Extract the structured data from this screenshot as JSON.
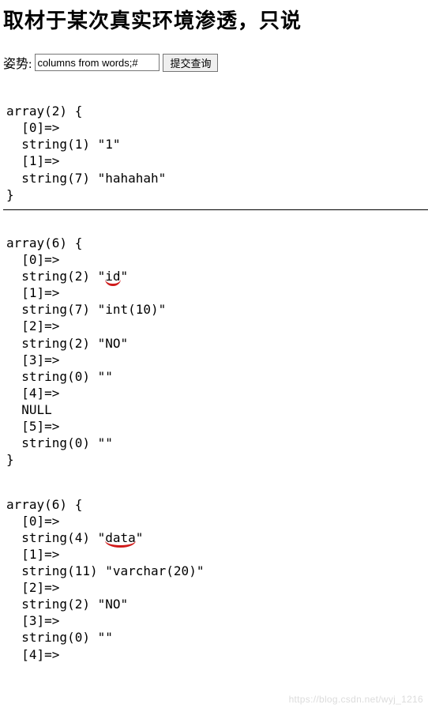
{
  "title": "取材于某次真实环境渗透，只说",
  "form": {
    "label": "姿势:",
    "input_value": "columns from words;#",
    "submit_label": "提交查询"
  },
  "dump1": {
    "header": "array(2) {",
    "lines": [
      "  [0]=>",
      "  string(1) \"1\"",
      "  [1]=>",
      "  string(7) \"hahahah\""
    ],
    "footer": "}"
  },
  "dump2": {
    "header": "array(6) {",
    "l0": "  [0]=>",
    "l1_pre": "  string(2) \"",
    "l1_mark": "id",
    "l1_post": "\"",
    "lines_rest": [
      "  [1]=>",
      "  string(7) \"int(10)\"",
      "  [2]=>",
      "  string(2) \"NO\"",
      "  [3]=>",
      "  string(0) \"\"",
      "  [4]=>",
      "  NULL",
      "  [5]=>",
      "  string(0) \"\""
    ],
    "footer": "}"
  },
  "dump3": {
    "header": "array(6) {",
    "l0": "  [0]=>",
    "l1_pre": "  string(4) \"",
    "l1_mark": "data",
    "l1_post": "\"",
    "lines_rest": [
      "  [1]=>",
      "  string(11) \"varchar(20)\"",
      "  [2]=>",
      "  string(2) \"NO\"",
      "  [3]=>",
      "  string(0) \"\"",
      "  [4]=>"
    ]
  },
  "watermark": "https://blog.csdn.net/wyj_1216"
}
